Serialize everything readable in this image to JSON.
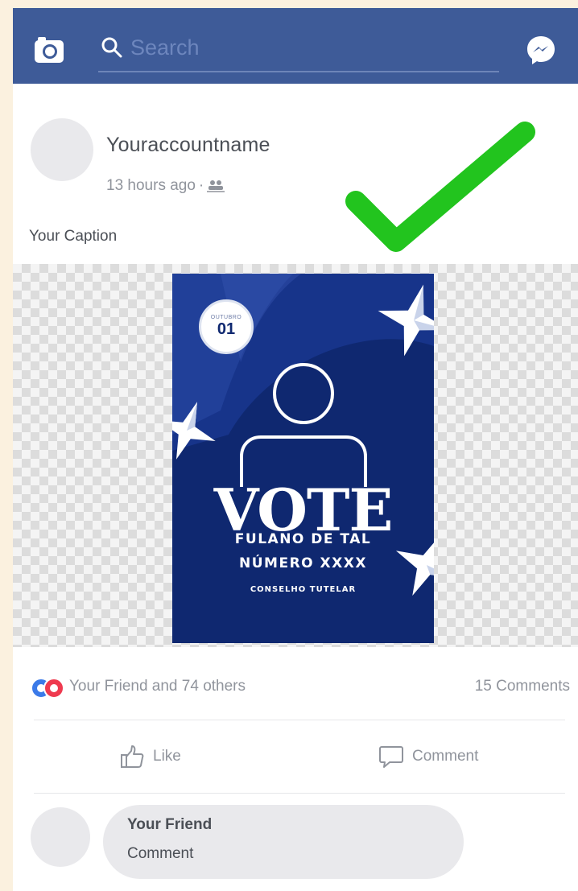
{
  "header": {
    "search_placeholder": "Search",
    "left_icon": "camera-icon",
    "right_icon": "messenger-icon"
  },
  "post": {
    "author": "Youraccountname",
    "time": "13 hours ago",
    "separator": "·",
    "audience_icon": "friends-icon",
    "caption": "Your Caption"
  },
  "overlay": {
    "icon": "checkmark-icon",
    "color": "#22c41e"
  },
  "poster": {
    "month": "OUTUBRO",
    "day": "01",
    "headline": "VOTE",
    "candidate_name": "FULANO DE TAL",
    "candidate_number": "NÚMERO XXXX",
    "council": "CONSELHO TUTELAR",
    "background_color": "#0f2870"
  },
  "engagement": {
    "reactions_text": "Your Friend and 74 others",
    "comments_count": "15 Comments"
  },
  "actions": {
    "like_label": "Like",
    "comment_label": "Comment"
  },
  "comment": {
    "author": "Your Friend",
    "text": "Comment"
  },
  "colors": {
    "header": "#3e5b98",
    "page_background": "#fbf1df",
    "like_reaction": "#3b7ae8",
    "love_reaction": "#ef3a4f"
  }
}
